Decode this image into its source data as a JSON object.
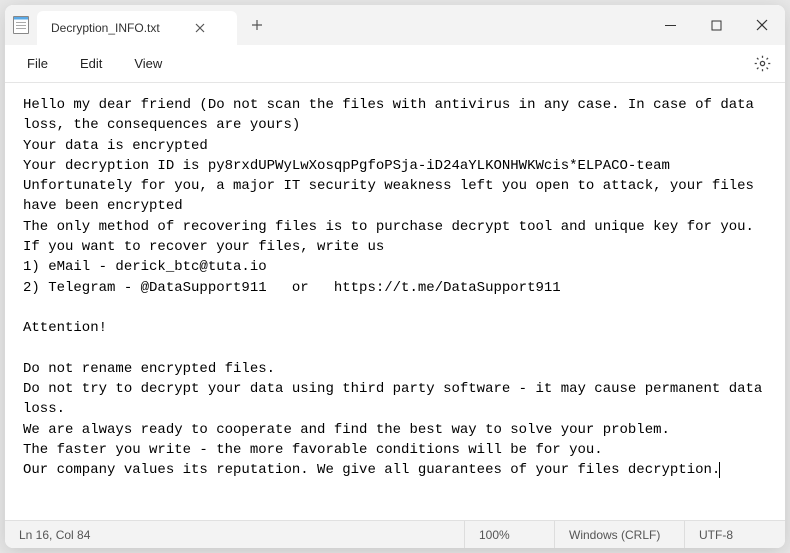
{
  "tab": {
    "title": "Decryption_INFO.txt"
  },
  "menu": {
    "file": "File",
    "edit": "Edit",
    "view": "View"
  },
  "content": {
    "text": "Hello my dear friend (Do not scan the files with antivirus in any case. In case of data loss, the consequences are yours)\nYour data is encrypted\nYour decryption ID is py8rxdUPWyLwXosqpPgfoPSja-iD24aYLKONHWKWcis*ELPACO-team\nUnfortunately for you, a major IT security weakness left you open to attack, your files have been encrypted\nThe only method of recovering files is to purchase decrypt tool and unique key for you.\nIf you want to recover your files, write us\n1) eMail - derick_btc@tuta.io\n2) Telegram - @DataSupport911   or   https://t.me/DataSupport911\n\nAttention!\n\nDo not rename encrypted files.\nDo not try to decrypt your data using third party software - it may cause permanent data loss.\nWe are always ready to cooperate and find the best way to solve your problem.\nThe faster you write - the more favorable conditions will be for you.\nOur company values its reputation. We give all guarantees of your files decryption."
  },
  "status": {
    "position": "Ln 16, Col 84",
    "zoom": "100%",
    "eol": "Windows (CRLF)",
    "encoding": "UTF-8"
  }
}
